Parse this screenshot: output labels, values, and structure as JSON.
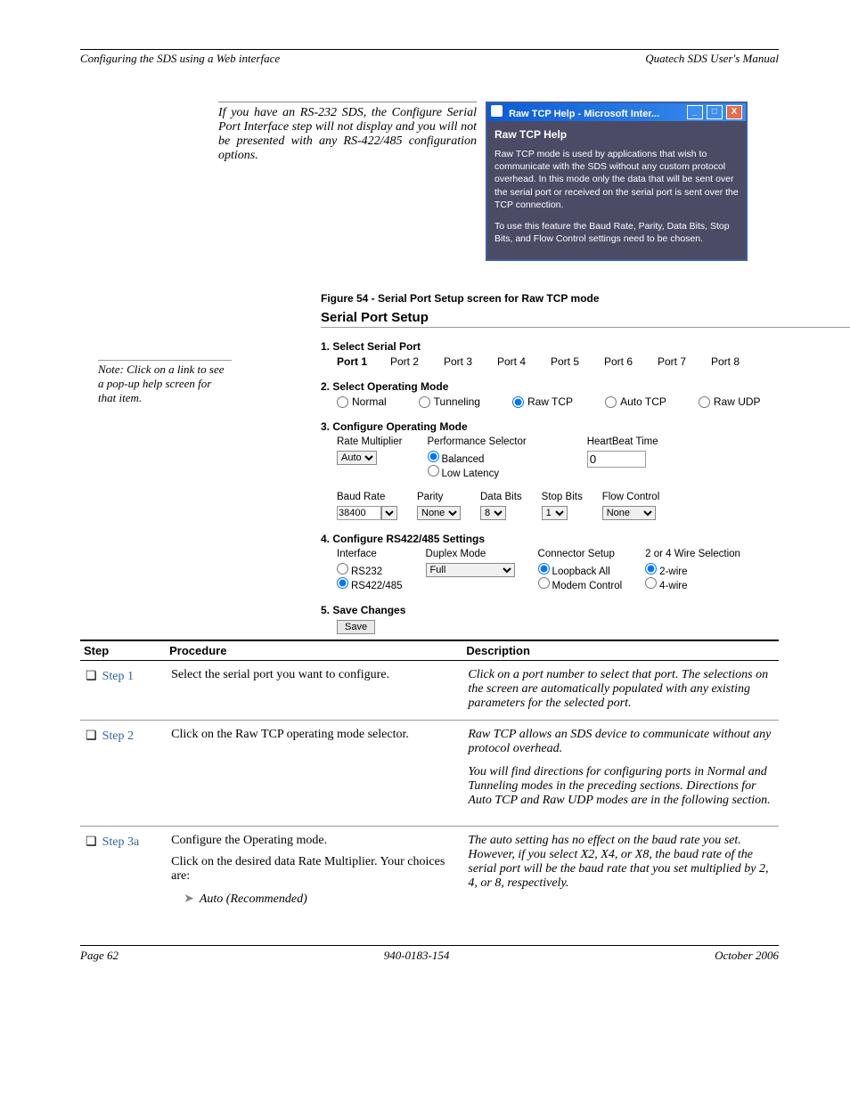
{
  "header": {
    "left": "Configuring the SDS using a Web interface",
    "right": "Quatech SDS User's Manual"
  },
  "intro": "If you have an RS-232 SDS, the Configure Serial Port Interface step will not display and you will not be presented with any RS-422/485 configuration options.",
  "help_window": {
    "title": "Raw TCP Help - Microsoft Inter...",
    "heading": "Raw TCP Help",
    "p1": "Raw TCP mode is used by applications that wish to communicate with the SDS without any custom protocol overhead. In this mode only the data that will be sent over the serial port or received on the serial port is sent over the TCP connection.",
    "p2": "To use this feature the Baud Rate, Parity, Data Bits, Stop Bits, and Flow Control settings need to be chosen."
  },
  "figure_caption": "Figure 54 - Serial Port Setup screen for Raw TCP mode",
  "margin_note": "Note: Click on a link to see a pop-up help screen for that item.",
  "setup": {
    "title": "Serial Port Setup",
    "h1": "1. Select Serial Port",
    "ports": [
      "Port 1",
      "Port 2",
      "Port 3",
      "Port 4",
      "Port 5",
      "Port 6",
      "Port 7",
      "Port 8"
    ],
    "h2": "2. Select Operating Mode",
    "modes": [
      "Normal",
      "Tunneling",
      "Raw TCP",
      "Auto TCP",
      "Raw UDP"
    ],
    "mode_selected": "Raw TCP",
    "h3": "3. Configure Operating Mode",
    "rate_lbl": "Rate Multiplier",
    "rate_val": "Auto",
    "perf_lbl": "Performance Selector",
    "perf_opts": [
      "Balanced",
      "Low Latency"
    ],
    "perf_selected": "Balanced",
    "hb_lbl": "HeartBeat Time",
    "hb_val": "0",
    "baud_lbl": "Baud Rate",
    "baud_val": "38400",
    "parity_lbl": "Parity",
    "parity_val": "None",
    "databits_lbl": "Data Bits",
    "databits_val": "8",
    "stopbits_lbl": "Stop Bits",
    "stopbits_val": "1",
    "flow_lbl": "Flow Control",
    "flow_val": "None",
    "h4": "4. Configure RS422/485 Settings",
    "iface_lbl": "Interface",
    "iface_opts": [
      "RS232",
      "RS422/485"
    ],
    "iface_selected": "RS422/485",
    "duplex_lbl": "Duplex Mode",
    "duplex_val": "Full",
    "conn_lbl": "Connector Setup",
    "conn_opts": [
      "Loopback All",
      "Modem Control"
    ],
    "conn_selected": "Loopback All",
    "wire_lbl": "2 or 4 Wire Selection",
    "wire_opts": [
      "2-wire",
      "4-wire"
    ],
    "wire_selected": "2-wire",
    "h5": "5. Save Changes",
    "save": "Save"
  },
  "table": {
    "cols": [
      "Step",
      "Procedure",
      "Description"
    ],
    "rows": [
      {
        "step": "Step 1",
        "proc": "Select the serial port you want to configure.",
        "desc": "Click on a port number to select that port. The selections on the screen are automatically populated with any existing parameters for the selected port."
      },
      {
        "step": "Step 2",
        "proc": "Click on the Raw TCP operating mode selector.",
        "desc1": "Raw TCP allows an SDS device to communicate without any protocol overhead.",
        "desc2": "You will find directions for configuring ports in Normal and Tunneling modes in the preceding sections. Directions for Auto TCP and Raw UDP modes are in the following section."
      },
      {
        "step": "Step 3a",
        "proc1": "Configure the Operating mode.",
        "proc2": "Click on the desired data Rate Multiplier. Your choices are:",
        "proc3": "Auto (Recommended)",
        "desc": "The auto setting has no effect on the baud rate you set. However, if you select X2, X4, or X8, the baud rate of the serial port will be the baud rate that you set multiplied by 2, 4, or 8, respectively."
      }
    ]
  },
  "footer": {
    "left": "Page 62",
    "center": "940-0183-154",
    "right": "October 2006"
  }
}
